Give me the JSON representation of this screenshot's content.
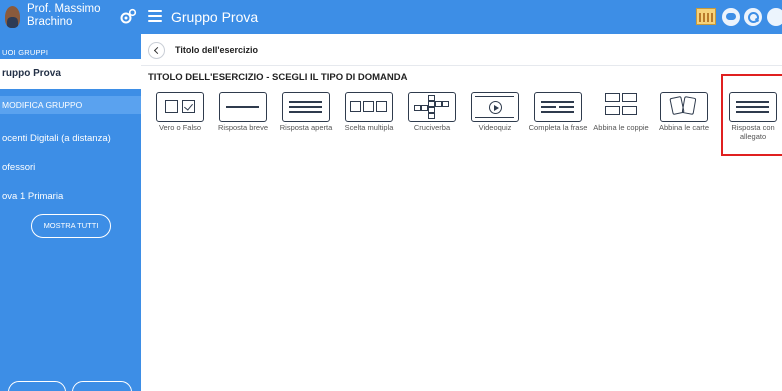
{
  "header": {
    "user_name": "Prof. Massimo Brachino",
    "app_title": "Gruppo Prova"
  },
  "sidebar": {
    "section_header": "UOI GRUPPI",
    "active_group": "ruppo Prova",
    "edit_group": "MODIFICA GRUPPO",
    "items": [
      {
        "label": "ocenti Digitali (a distanza)"
      },
      {
        "label": "ofessori"
      },
      {
        "label": "ova 1 Primaria"
      }
    ],
    "show_all_label": "MOSTRA TUTTI"
  },
  "main": {
    "breadcrumb_title": "Titolo dell'esercizio",
    "section_title": "TITOLO DELL'ESERCIZIO - SCEGLI IL TIPO DI DOMANDA",
    "question_types": [
      {
        "label": "Vero o Falso",
        "icon": "true-false-icon"
      },
      {
        "label": "Risposta breve",
        "icon": "short-answer-icon"
      },
      {
        "label": "Risposta aperta",
        "icon": "open-answer-icon"
      },
      {
        "label": "Scelta multipla",
        "icon": "multiple-choice-icon"
      },
      {
        "label": "Cruciverba",
        "icon": "crossword-icon"
      },
      {
        "label": "Videoquiz",
        "icon": "video-quiz-icon"
      },
      {
        "label": "Completa la frase",
        "icon": "complete-sentence-icon"
      },
      {
        "label": "Abbina le coppie",
        "icon": "match-pairs-icon"
      },
      {
        "label": "Abbina le carte",
        "icon": "match-cards-icon"
      },
      {
        "label": "Risposta con allegato",
        "icon": "attachment-answer-icon"
      }
    ],
    "highlighted_type": "Risposta con allegato"
  },
  "colors": {
    "primary": "#3d8ee6",
    "highlight": "#e02020",
    "icon_stroke": "#2f3b4d"
  }
}
